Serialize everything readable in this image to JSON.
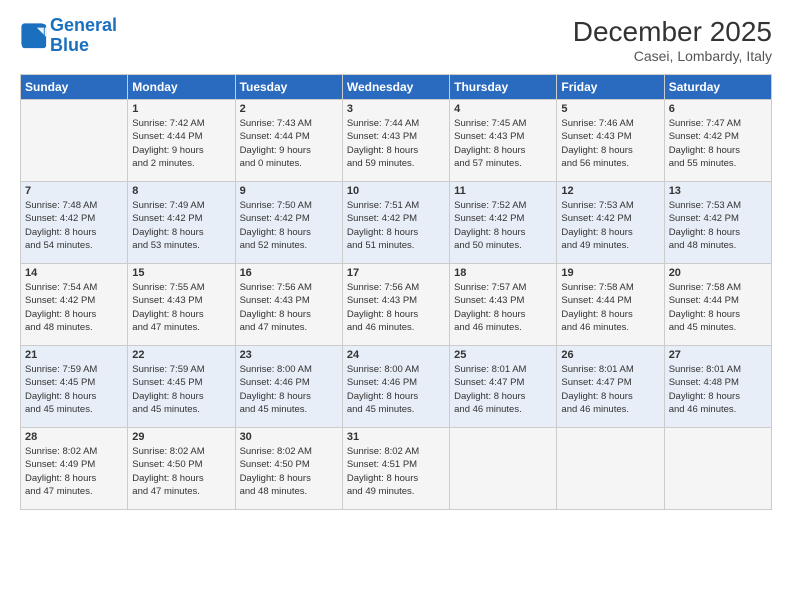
{
  "logo": {
    "line1": "General",
    "line2": "Blue"
  },
  "title": "December 2025",
  "location": "Casei, Lombardy, Italy",
  "days_of_week": [
    "Sunday",
    "Monday",
    "Tuesday",
    "Wednesday",
    "Thursday",
    "Friday",
    "Saturday"
  ],
  "weeks": [
    [
      {
        "day": "",
        "content": ""
      },
      {
        "day": "1",
        "content": "Sunrise: 7:42 AM\nSunset: 4:44 PM\nDaylight: 9 hours\nand 2 minutes."
      },
      {
        "day": "2",
        "content": "Sunrise: 7:43 AM\nSunset: 4:44 PM\nDaylight: 9 hours\nand 0 minutes."
      },
      {
        "day": "3",
        "content": "Sunrise: 7:44 AM\nSunset: 4:43 PM\nDaylight: 8 hours\nand 59 minutes."
      },
      {
        "day": "4",
        "content": "Sunrise: 7:45 AM\nSunset: 4:43 PM\nDaylight: 8 hours\nand 57 minutes."
      },
      {
        "day": "5",
        "content": "Sunrise: 7:46 AM\nSunset: 4:43 PM\nDaylight: 8 hours\nand 56 minutes."
      },
      {
        "day": "6",
        "content": "Sunrise: 7:47 AM\nSunset: 4:42 PM\nDaylight: 8 hours\nand 55 minutes."
      }
    ],
    [
      {
        "day": "7",
        "content": "Sunrise: 7:48 AM\nSunset: 4:42 PM\nDaylight: 8 hours\nand 54 minutes."
      },
      {
        "day": "8",
        "content": "Sunrise: 7:49 AM\nSunset: 4:42 PM\nDaylight: 8 hours\nand 53 minutes."
      },
      {
        "day": "9",
        "content": "Sunrise: 7:50 AM\nSunset: 4:42 PM\nDaylight: 8 hours\nand 52 minutes."
      },
      {
        "day": "10",
        "content": "Sunrise: 7:51 AM\nSunset: 4:42 PM\nDaylight: 8 hours\nand 51 minutes."
      },
      {
        "day": "11",
        "content": "Sunrise: 7:52 AM\nSunset: 4:42 PM\nDaylight: 8 hours\nand 50 minutes."
      },
      {
        "day": "12",
        "content": "Sunrise: 7:53 AM\nSunset: 4:42 PM\nDaylight: 8 hours\nand 49 minutes."
      },
      {
        "day": "13",
        "content": "Sunrise: 7:53 AM\nSunset: 4:42 PM\nDaylight: 8 hours\nand 48 minutes."
      }
    ],
    [
      {
        "day": "14",
        "content": "Sunrise: 7:54 AM\nSunset: 4:42 PM\nDaylight: 8 hours\nand 48 minutes."
      },
      {
        "day": "15",
        "content": "Sunrise: 7:55 AM\nSunset: 4:43 PM\nDaylight: 8 hours\nand 47 minutes."
      },
      {
        "day": "16",
        "content": "Sunrise: 7:56 AM\nSunset: 4:43 PM\nDaylight: 8 hours\nand 47 minutes."
      },
      {
        "day": "17",
        "content": "Sunrise: 7:56 AM\nSunset: 4:43 PM\nDaylight: 8 hours\nand 46 minutes."
      },
      {
        "day": "18",
        "content": "Sunrise: 7:57 AM\nSunset: 4:43 PM\nDaylight: 8 hours\nand 46 minutes."
      },
      {
        "day": "19",
        "content": "Sunrise: 7:58 AM\nSunset: 4:44 PM\nDaylight: 8 hours\nand 46 minutes."
      },
      {
        "day": "20",
        "content": "Sunrise: 7:58 AM\nSunset: 4:44 PM\nDaylight: 8 hours\nand 45 minutes."
      }
    ],
    [
      {
        "day": "21",
        "content": "Sunrise: 7:59 AM\nSunset: 4:45 PM\nDaylight: 8 hours\nand 45 minutes."
      },
      {
        "day": "22",
        "content": "Sunrise: 7:59 AM\nSunset: 4:45 PM\nDaylight: 8 hours\nand 45 minutes."
      },
      {
        "day": "23",
        "content": "Sunrise: 8:00 AM\nSunset: 4:46 PM\nDaylight: 8 hours\nand 45 minutes."
      },
      {
        "day": "24",
        "content": "Sunrise: 8:00 AM\nSunset: 4:46 PM\nDaylight: 8 hours\nand 45 minutes."
      },
      {
        "day": "25",
        "content": "Sunrise: 8:01 AM\nSunset: 4:47 PM\nDaylight: 8 hours\nand 46 minutes."
      },
      {
        "day": "26",
        "content": "Sunrise: 8:01 AM\nSunset: 4:47 PM\nDaylight: 8 hours\nand 46 minutes."
      },
      {
        "day": "27",
        "content": "Sunrise: 8:01 AM\nSunset: 4:48 PM\nDaylight: 8 hours\nand 46 minutes."
      }
    ],
    [
      {
        "day": "28",
        "content": "Sunrise: 8:02 AM\nSunset: 4:49 PM\nDaylight: 8 hours\nand 47 minutes."
      },
      {
        "day": "29",
        "content": "Sunrise: 8:02 AM\nSunset: 4:50 PM\nDaylight: 8 hours\nand 47 minutes."
      },
      {
        "day": "30",
        "content": "Sunrise: 8:02 AM\nSunset: 4:50 PM\nDaylight: 8 hours\nand 48 minutes."
      },
      {
        "day": "31",
        "content": "Sunrise: 8:02 AM\nSunset: 4:51 PM\nDaylight: 8 hours\nand 49 minutes."
      },
      {
        "day": "",
        "content": ""
      },
      {
        "day": "",
        "content": ""
      },
      {
        "day": "",
        "content": ""
      }
    ]
  ]
}
